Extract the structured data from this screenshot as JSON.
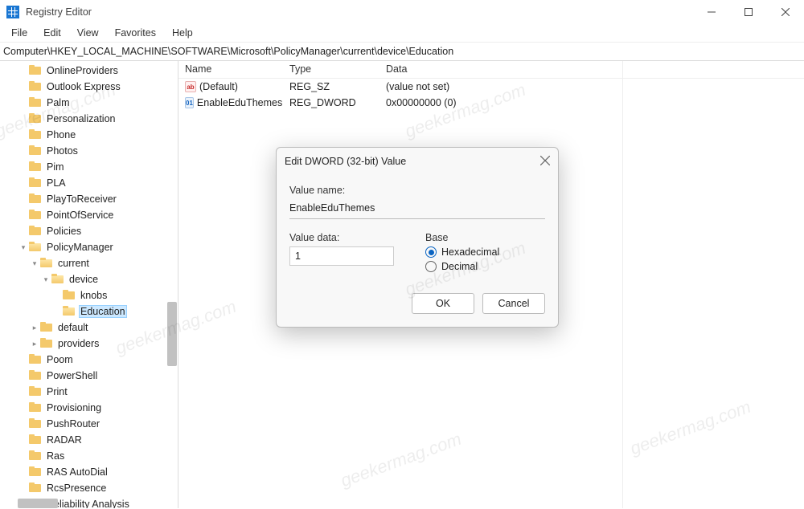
{
  "title": "Registry Editor",
  "menu": {
    "file": "File",
    "edit": "Edit",
    "view": "View",
    "favorites": "Favorites",
    "help": "Help"
  },
  "address": "Computer\\HKEY_LOCAL_MACHINE\\SOFTWARE\\Microsoft\\PolicyManager\\current\\device\\Education",
  "tree": [
    {
      "d": 1,
      "exp": "",
      "name": "OnlineProviders"
    },
    {
      "d": 1,
      "exp": "",
      "name": "Outlook Express"
    },
    {
      "d": 1,
      "exp": "",
      "name": "Palm"
    },
    {
      "d": 1,
      "exp": "",
      "name": "Personalization"
    },
    {
      "d": 1,
      "exp": "",
      "name": "Phone"
    },
    {
      "d": 1,
      "exp": "",
      "name": "Photos"
    },
    {
      "d": 1,
      "exp": "",
      "name": "Pim"
    },
    {
      "d": 1,
      "exp": "",
      "name": "PLA"
    },
    {
      "d": 1,
      "exp": "",
      "name": "PlayToReceiver"
    },
    {
      "d": 1,
      "exp": "",
      "name": "PointOfService"
    },
    {
      "d": 1,
      "exp": "",
      "name": "Policies"
    },
    {
      "d": 1,
      "exp": "v",
      "name": "PolicyManager",
      "open": true
    },
    {
      "d": 2,
      "exp": "v",
      "name": "current",
      "open": true
    },
    {
      "d": 3,
      "exp": "v",
      "name": "device",
      "open": true
    },
    {
      "d": 4,
      "exp": "",
      "name": "knobs"
    },
    {
      "d": 4,
      "exp": "",
      "name": "Education",
      "sel": true,
      "open": true
    },
    {
      "d": 2,
      "exp": ">",
      "name": "default"
    },
    {
      "d": 2,
      "exp": ">",
      "name": "providers"
    },
    {
      "d": 1,
      "exp": "",
      "name": "Poom"
    },
    {
      "d": 1,
      "exp": "",
      "name": "PowerShell"
    },
    {
      "d": 1,
      "exp": "",
      "name": "Print"
    },
    {
      "d": 1,
      "exp": "",
      "name": "Provisioning"
    },
    {
      "d": 1,
      "exp": "",
      "name": "PushRouter"
    },
    {
      "d": 1,
      "exp": "",
      "name": "RADAR"
    },
    {
      "d": 1,
      "exp": "",
      "name": "Ras"
    },
    {
      "d": 1,
      "exp": "",
      "name": "RAS AutoDial"
    },
    {
      "d": 1,
      "exp": "",
      "name": "RcsPresence"
    },
    {
      "d": 1,
      "exp": "",
      "name": "Reliability Analysis"
    }
  ],
  "cols": {
    "name": "Name",
    "type": "Type",
    "data": "Data"
  },
  "values": [
    {
      "icon": "str",
      "name": "(Default)",
      "type": "REG_SZ",
      "data": "(value not set)"
    },
    {
      "icon": "dw",
      "name": "EnableEduThemes",
      "type": "REG_DWORD",
      "data": "0x00000000 (0)"
    }
  ],
  "dialog": {
    "title": "Edit DWORD (32-bit) Value",
    "value_name_label": "Value name:",
    "value_name": "EnableEduThemes",
    "value_data_label": "Value data:",
    "value_data": "1",
    "base_label": "Base",
    "hex": "Hexadecimal",
    "dec": "Decimal",
    "ok": "OK",
    "cancel": "Cancel"
  },
  "watermark": "geekermag.com"
}
